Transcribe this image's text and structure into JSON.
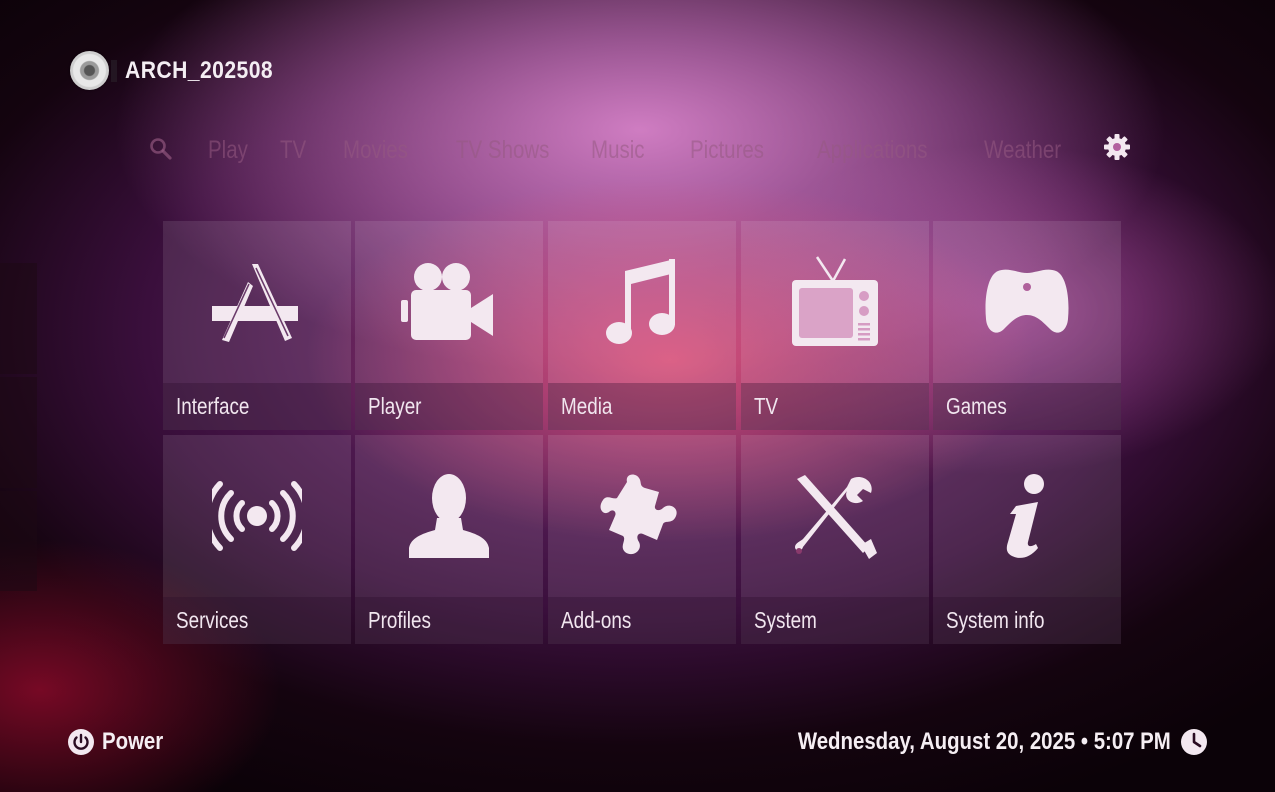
{
  "header": {
    "profile_name": "ARCH_202508"
  },
  "nav": {
    "search_icon": "search-icon",
    "settings_icon": "gear-icon",
    "items": [
      {
        "label": "Play",
        "active": true
      },
      {
        "label": "TV"
      },
      {
        "label": "Movies"
      },
      {
        "label": "TV Shows"
      },
      {
        "label": "Music"
      },
      {
        "label": "Pictures"
      },
      {
        "label": "Applications"
      },
      {
        "label": "Weather"
      }
    ]
  },
  "settings_tiles": [
    {
      "label": "Interface",
      "icon": "app-store-icon"
    },
    {
      "label": "Player",
      "icon": "video-camera-icon"
    },
    {
      "label": "Media",
      "icon": "music-note-icon"
    },
    {
      "label": "TV",
      "icon": "television-icon"
    },
    {
      "label": "Games",
      "icon": "gamepad-icon"
    },
    {
      "label": "Services",
      "icon": "broadcast-icon"
    },
    {
      "label": "Profiles",
      "icon": "user-icon"
    },
    {
      "label": "Add-ons",
      "icon": "puzzle-icon"
    },
    {
      "label": "System",
      "icon": "tools-icon"
    },
    {
      "label": "System info",
      "icon": "info-icon"
    }
  ],
  "footer": {
    "power_label": "Power",
    "datetime": "Wednesday, August 20, 2025 • 5:07 PM"
  },
  "colors": {
    "icon": "#f3e8f0",
    "accent": "#e8567a"
  }
}
